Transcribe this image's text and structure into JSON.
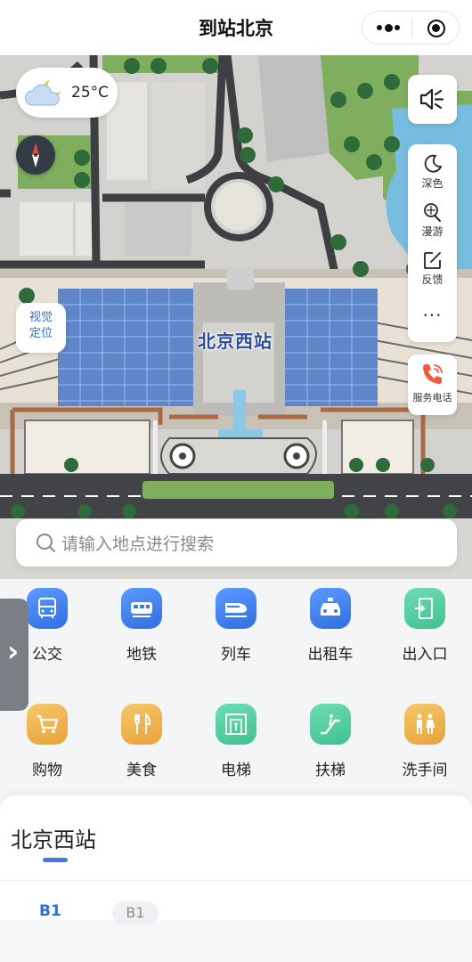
{
  "header": {
    "title": "到站北京"
  },
  "map": {
    "station_label": "北京西站",
    "weather": {
      "temperature": "25°C",
      "icon": "partly-cloudy-night-icon"
    },
    "visual_locate": {
      "line1": "视觉",
      "line2": "定位"
    },
    "tools": [
      {
        "label": "深色",
        "icon": "moon-icon"
      },
      {
        "label": "漫游",
        "icon": "roam-icon"
      },
      {
        "label": "反馈",
        "icon": "edit-icon"
      },
      {
        "label": "···",
        "icon": "more-icon"
      }
    ],
    "service_phone": {
      "label": "服务电话",
      "icon": "phone-icon"
    },
    "sound_icon": "speaker-icon"
  },
  "search": {
    "placeholder": "请输入地点进行搜索"
  },
  "categories": [
    {
      "label": "公交",
      "icon": "bus-icon",
      "color": "#3c7be8"
    },
    {
      "label": "地铁",
      "icon": "subway-icon",
      "color": "#3c7be8"
    },
    {
      "label": "列车",
      "icon": "train-icon",
      "color": "#3c7be8"
    },
    {
      "label": "出租车",
      "icon": "taxi-icon",
      "color": "#3c7be8"
    },
    {
      "label": "出入口",
      "icon": "exit-door-icon",
      "color": "#46c796"
    },
    {
      "label": "购物",
      "icon": "shopping-cart-icon",
      "color": "#eeac45"
    },
    {
      "label": "美食",
      "icon": "fork-knife-icon",
      "color": "#eeac45"
    },
    {
      "label": "电梯",
      "icon": "elevator-icon",
      "color": "#46c796"
    },
    {
      "label": "扶梯",
      "icon": "escalator-icon",
      "color": "#46c796"
    },
    {
      "label": "洗手间",
      "icon": "restroom-icon",
      "color": "#eeac45"
    }
  ],
  "sheet": {
    "station_name": "北京西站",
    "floor_active": "B1",
    "floor_option": "B1"
  }
}
